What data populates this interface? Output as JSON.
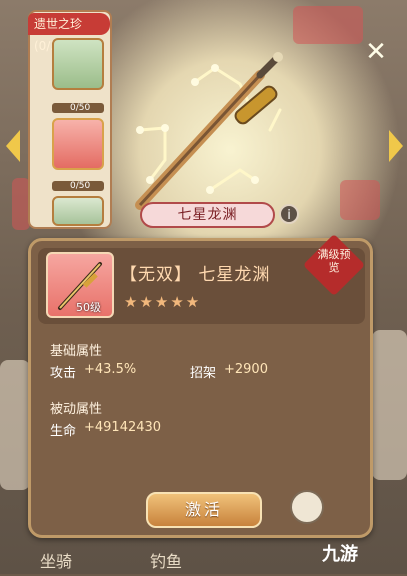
{
  "treasure": {
    "title": "遗世之珍(0/3)",
    "items": [
      {
        "progress": "0/50",
        "fraction": 0
      },
      {
        "progress": "0/50",
        "fraction": 0
      },
      {
        "progress": "",
        "fraction": 0
      }
    ]
  },
  "weapon": {
    "name": "七星龙渊",
    "banner_name": "七星龙渊",
    "rarity_tag": "【无双】",
    "level": "50级",
    "stars": "★★★★★",
    "stamp": "满级预览"
  },
  "base_attributes": {
    "title": "基础属性",
    "attack_label": "攻击",
    "attack_value": "+43.5%",
    "parry_label": "招架",
    "parry_value": "+2900"
  },
  "passive_attributes": {
    "title": "被动属性",
    "life_label": "生命",
    "life_value": "+49142430"
  },
  "buttons": {
    "activate": "激活",
    "close": "✕",
    "info": "i"
  },
  "bottom_tabs": [
    "坐骑",
    "钓鱼"
  ],
  "watermark": "九游",
  "colors": {
    "accent": "#c73c36",
    "gold": "#e6b33c",
    "panel": "#7d6047"
  }
}
